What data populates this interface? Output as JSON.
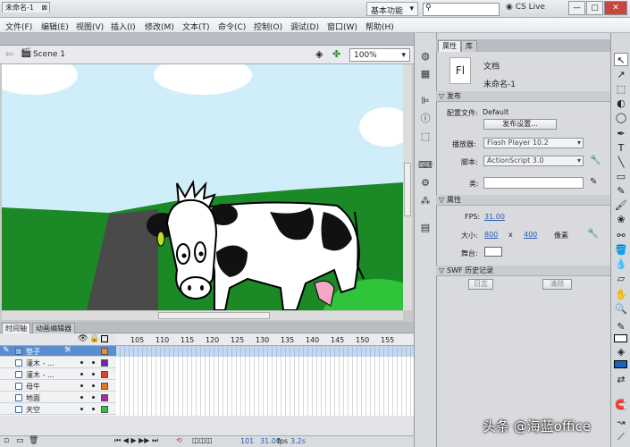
{
  "app": {
    "logo": "Fl",
    "workspace": "基本功能",
    "cs_live": "CS Live",
    "window_buttons": [
      "—",
      "▢",
      "✕"
    ]
  },
  "menu": [
    "文件(F)",
    "编辑(E)",
    "视图(V)",
    "插入(I)",
    "修改(M)",
    "文本(T)",
    "命令(C)",
    "控制(O)",
    "调试(D)",
    "窗口(W)",
    "帮助(H)"
  ],
  "document": {
    "tab": "未命名-1",
    "scene": "Scene 1",
    "zoom": "100%"
  },
  "timeline": {
    "tabs": [
      "时间轴",
      "动画编辑器"
    ],
    "ruler": [
      "105",
      "110",
      "115",
      "120",
      "125",
      "130",
      "135",
      "140",
      "145",
      "150",
      "155"
    ],
    "layers": [
      {
        "name": "垫子",
        "color": "#e8902a",
        "selected": true
      },
      {
        "name": "灌木 - ...",
        "color": "#6b2aa8",
        "selected": false
      },
      {
        "name": "灌木 - ...",
        "color": "#d8452c",
        "selected": false
      },
      {
        "name": "母牛",
        "color": "#e07a1e",
        "selected": false
      },
      {
        "name": "地面",
        "color": "#a52ca0",
        "selected": false
      },
      {
        "name": "天空",
        "color": "#2ec43a",
        "selected": false
      }
    ],
    "footer": {
      "frame": "101",
      "fps": "31.00",
      "fps_unit": "fps",
      "time": "3.2s"
    }
  },
  "properties": {
    "tabs": [
      "属性",
      "库"
    ],
    "doc_icon": "Fl",
    "doc_type": "文档",
    "doc_name": "未命名-1",
    "publish": {
      "header": "发布",
      "profile_label": "配置文件:",
      "profile_value": "Default",
      "settings_button": "发布设置...",
      "player_label": "播放器:",
      "player_value": "Flash Player 10.2",
      "script_label": "脚本:",
      "script_value": "ActionScript 3.0",
      "class_label": "类:"
    },
    "attributes": {
      "header": "属性",
      "fps_label": "FPS:",
      "fps_value": "31.00",
      "size_label": "大小:",
      "width": "800",
      "x": "x",
      "height": "400",
      "unit": "像素",
      "stage_label": "舞台:"
    },
    "history": {
      "header": "SWF 历史记录",
      "log_button": "日志",
      "clear_button": "清除"
    }
  },
  "watermark": "头条 @海蓝office",
  "colors": {
    "stage_sky": "#cfeefa",
    "grass": "#1b8a26",
    "road": "#4a4a4a",
    "selected_layer": "#5a8ed0"
  }
}
